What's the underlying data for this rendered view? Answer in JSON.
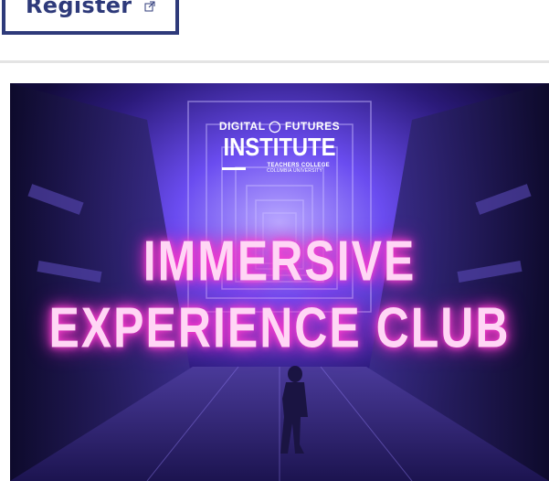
{
  "register": {
    "label": "Register",
    "icon": "external-link-icon"
  },
  "banner": {
    "logo_top": "DIGITAL ◯ FUTURES",
    "logo_main": "INSTITUTE",
    "logo_sub1": "TEACHERS COLLEGE",
    "logo_sub2": "COLUMBIA UNIVERSITY",
    "title_line1": "IMMERSIVE",
    "title_line2": "EXPERIENCE CLUB"
  },
  "colors": {
    "button_border": "#2e3a7a",
    "neon_pink": "#ff3fd0",
    "divider": "#e4e4e4"
  }
}
